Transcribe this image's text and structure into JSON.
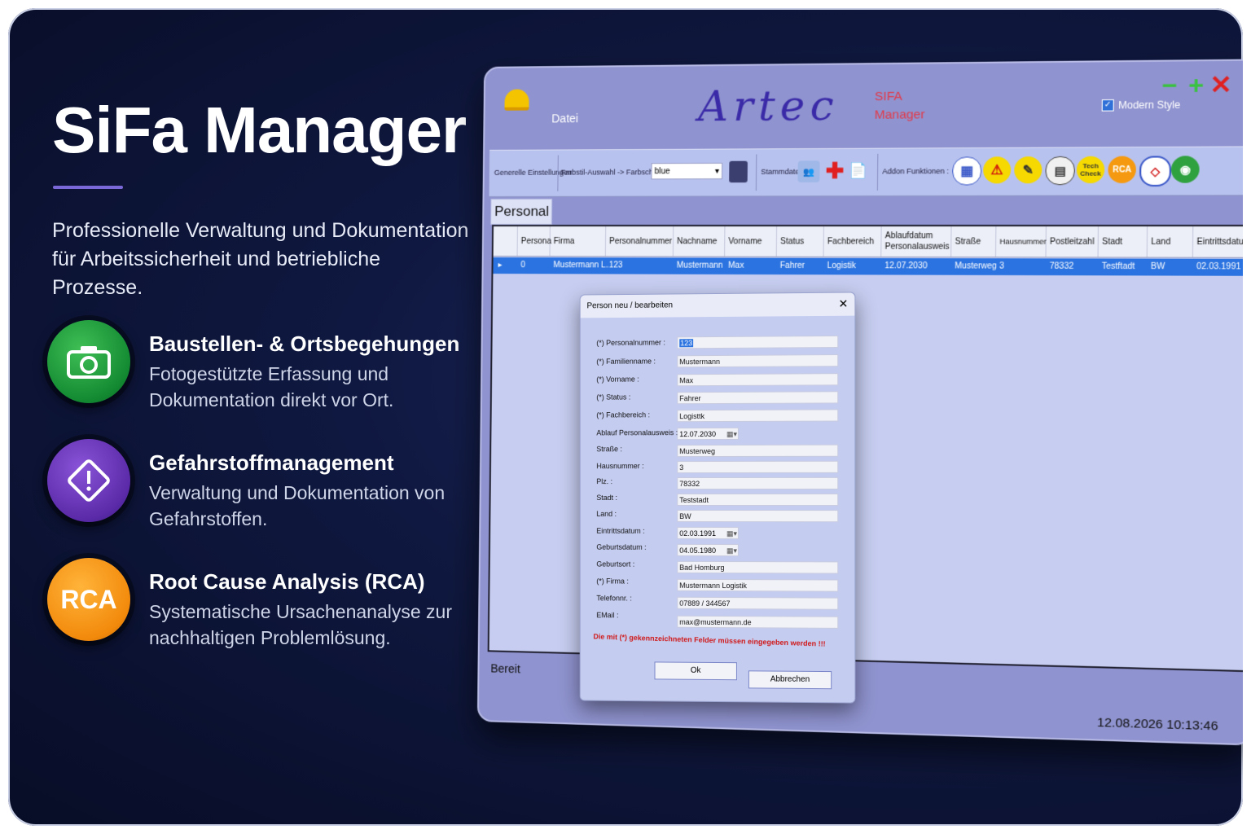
{
  "hero": {
    "title": "SiFa Manager",
    "subtitle": "Professionelle Verwaltung und Dokumentation für Arbeitssicherheit und betriebliche Prozesse."
  },
  "features": [
    {
      "title": "Baustellen- & Ortsbegehungen",
      "desc": "Fotogestützte Erfassung und Dokumentation direkt vor Ort.",
      "icon": "camera-icon"
    },
    {
      "title": "Gefahrstoffmanagement",
      "desc": "Verwaltung und Dokumentation von Gefahrstoffen.",
      "icon": "hazard-diamond-icon"
    },
    {
      "title": "Root Cause Analysis (RCA)",
      "desc": "Systematische Ursachenanalyse zur nachhaltigen Problemlösung.",
      "icon_text": "RCA"
    }
  ],
  "app": {
    "menu": "Datei",
    "logo": "Artec",
    "product": [
      "SIFA",
      "Manager"
    ],
    "modern_style": "Modern Style",
    "toolbar": {
      "general": "Generelle Einstellungen",
      "color_select": "Farbstil-Auswahl -> Farbschema",
      "color_value": "blue",
      "stammdaten": "Stammdaten",
      "addon": "Addon Funktionen :",
      "rca": "RCA",
      "techcheck": "Tech Check"
    },
    "tab": "Personal",
    "columns": [
      "Persona",
      "Firma",
      "Personalnummer",
      "Nachname",
      "Vorname",
      "Status",
      "Fachbereich",
      "Ablaufdatum Personalausweis",
      "Straße",
      "Hausnummer",
      "Postleitzahl",
      "Stadt",
      "Land",
      "Eintrittsdatum"
    ],
    "row": [
      "0",
      "Mustermann L...",
      "123",
      "Mustermann",
      "Max",
      "Fahrer",
      "Logistik",
      "12.07.2030",
      "Musterweg",
      "3",
      "78332",
      "Testftadt",
      "BW",
      "02.03.1991"
    ],
    "status": "Bereit",
    "clock": "12.08.2026 10:13:46"
  },
  "dialog": {
    "title": "Person neu / bearbeiten",
    "fields": [
      {
        "label": "(*) Personalnummer :",
        "value": "123"
      },
      {
        "label": "(*) Familienname :",
        "value": "Mustermann"
      },
      {
        "label": "(*) Vorname :",
        "value": "Max"
      },
      {
        "label": "(*) Status :",
        "value": "Fahrer"
      },
      {
        "label": "(*) Fachbereich :",
        "value": "Logisttk"
      },
      {
        "label": "Ablauf Personalausweis :",
        "value": "12.07.2030"
      },
      {
        "label": "Straße :",
        "value": "Musterweg"
      },
      {
        "label": "Hausnummer :",
        "value": "3"
      },
      {
        "label": "Plz. :",
        "value": "78332"
      },
      {
        "label": "Stadt :",
        "value": "Teststadt"
      },
      {
        "label": "Land :",
        "value": "BW"
      },
      {
        "label": "Eintrittsdatum :",
        "value": "02.03.1991"
      },
      {
        "label": "Geburtsdatum :",
        "value": "04.05.1980"
      },
      {
        "label": "Geburtsort :",
        "value": "Bad Homburg"
      },
      {
        "label": "(*) Firma :",
        "value": "Mustermann Logistik"
      },
      {
        "label": "Telefonnr. :",
        "value": "07889 / 344567"
      },
      {
        "label": "EMail :",
        "value": "max@mustermann.de"
      }
    ],
    "required_note": "Die mit (*) gekennzeichneten Felder müssen eingegeben werden !!!",
    "ok": "Ok",
    "cancel": "Abbrechen"
  }
}
